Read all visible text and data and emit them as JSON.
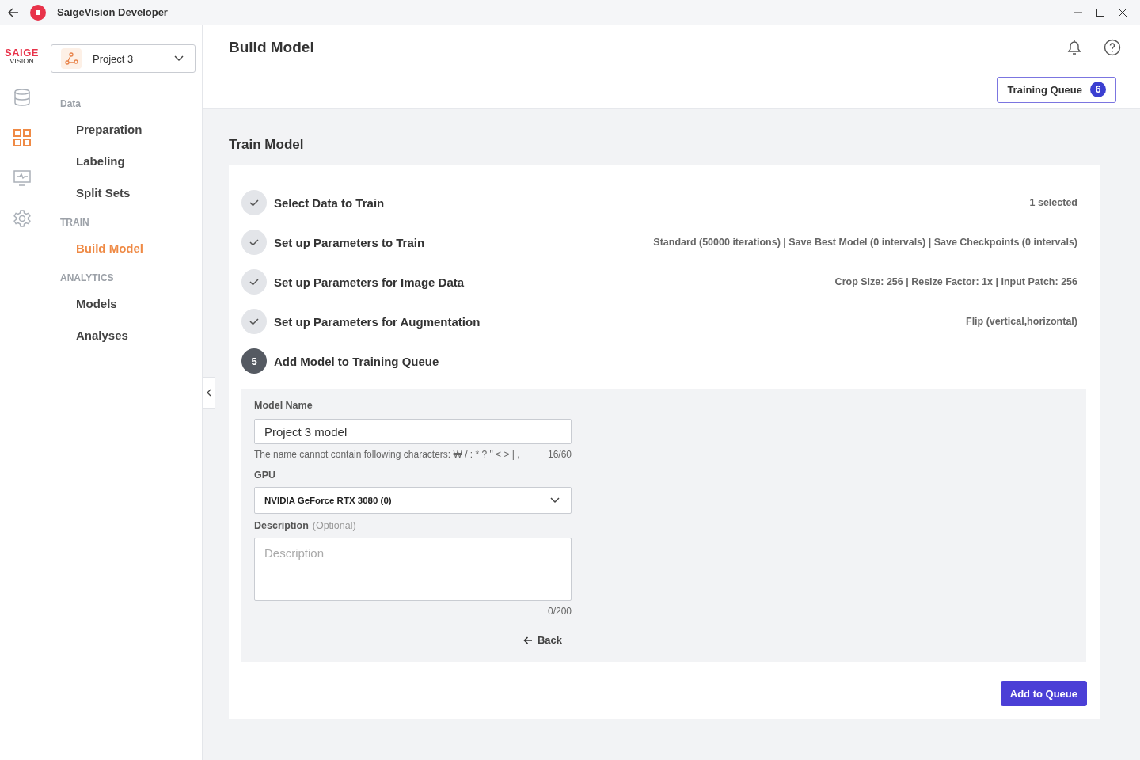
{
  "window": {
    "title": "SaigeVision Developer"
  },
  "logo": {
    "line1": "SAIGE",
    "line2": "VISION"
  },
  "rail": [
    {
      "kind": "database",
      "selected": false
    },
    {
      "kind": "grid",
      "selected": true
    },
    {
      "kind": "monitor",
      "selected": false
    },
    {
      "kind": "gear",
      "selected": false
    }
  ],
  "project_select": {
    "value": "Project 3"
  },
  "sidebar": [
    {
      "heading": "Data",
      "items": [
        {
          "label": "Preparation",
          "selected": false
        },
        {
          "label": "Labeling",
          "selected": false
        },
        {
          "label": "Split Sets",
          "selected": false
        }
      ]
    },
    {
      "heading": "TRAIN",
      "items": [
        {
          "label": "Build Model",
          "selected": true
        }
      ]
    },
    {
      "heading": "ANALYTICS",
      "items": [
        {
          "label": "Models",
          "selected": false
        },
        {
          "label": "Analyses",
          "selected": false
        }
      ]
    }
  ],
  "page_title": "Build Model",
  "training_queue": {
    "label": "Training Queue",
    "count": "6"
  },
  "section_title": "Train Model",
  "steps": [
    {
      "kind": "done",
      "title": "Select Data to Train",
      "summary": "1 selected"
    },
    {
      "kind": "done",
      "title": "Set up Parameters to Train",
      "summary": "Standard (50000 iterations) | Save Best Model (0 intervals) | Save Checkpoints (0 intervals)"
    },
    {
      "kind": "done",
      "title": "Set up Parameters for Image Data",
      "summary": "Crop Size: 256 | Resize Factor: 1x | Input Patch: 256"
    },
    {
      "kind": "done",
      "title": "Set up Parameters for Augmentation",
      "summary": "Flip (vertical,horizontal)"
    },
    {
      "kind": "current",
      "number": "5",
      "title": "Add Model to Training Queue"
    }
  ],
  "form": {
    "model_name": {
      "label": "Model Name",
      "value": "Project 3 model",
      "hint": "The name cannot contain following characters: ₩ / : * ? \" < > | ,",
      "counter": "16/60"
    },
    "gpu": {
      "label": "GPU",
      "value": "NVIDIA GeForce RTX 3080 (0)"
    },
    "description": {
      "label": "Description",
      "optional": "(Optional)",
      "placeholder": "Description",
      "counter": "0/200"
    },
    "back": "Back"
  },
  "add_button": "Add to Queue"
}
